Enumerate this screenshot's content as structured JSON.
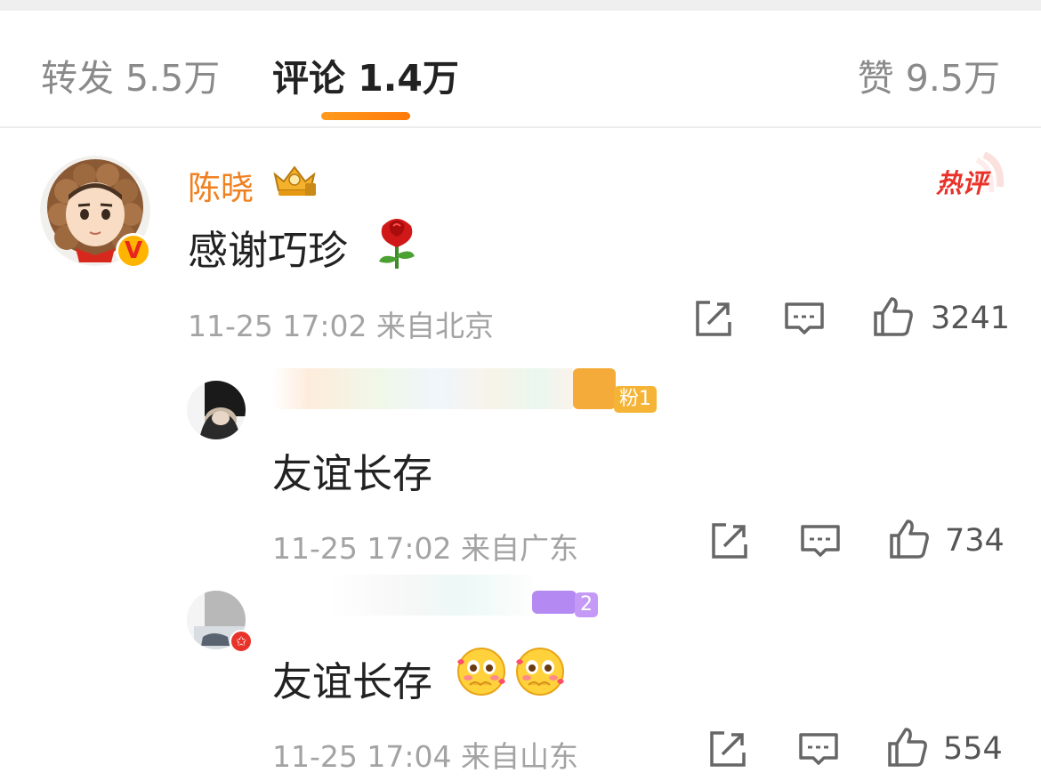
{
  "tabs": {
    "reposts": "转发 5.5万",
    "comments": "评论 1.4万",
    "likes": "赞 9.5万"
  },
  "comment": {
    "username": "陈晓",
    "hot_label": "热评",
    "text": "感谢巧珍",
    "time": "11-25 17:02",
    "location": "来自北京",
    "likes": "3241"
  },
  "replies": [
    {
      "fan_badge": "粉1",
      "text": "友谊长存",
      "time": "11-25 17:02",
      "location": "来自广东",
      "likes": "734"
    },
    {
      "fan_badge": "2",
      "text": "友谊长存",
      "time": "11-25 17:04",
      "location": "来自山东",
      "likes": "554"
    }
  ],
  "icons": {
    "share": "share-icon",
    "comment": "comment-icon",
    "like": "thumbs-up-icon",
    "verified": "verified-v-icon",
    "crown": "crown-badge-icon",
    "rose": "rose-emoji",
    "shy": "shy-face-emoji"
  },
  "colors": {
    "accent": "#ff8a12",
    "username": "#f08020",
    "hot": "#e8322a",
    "meta": "#a3a3a3"
  }
}
